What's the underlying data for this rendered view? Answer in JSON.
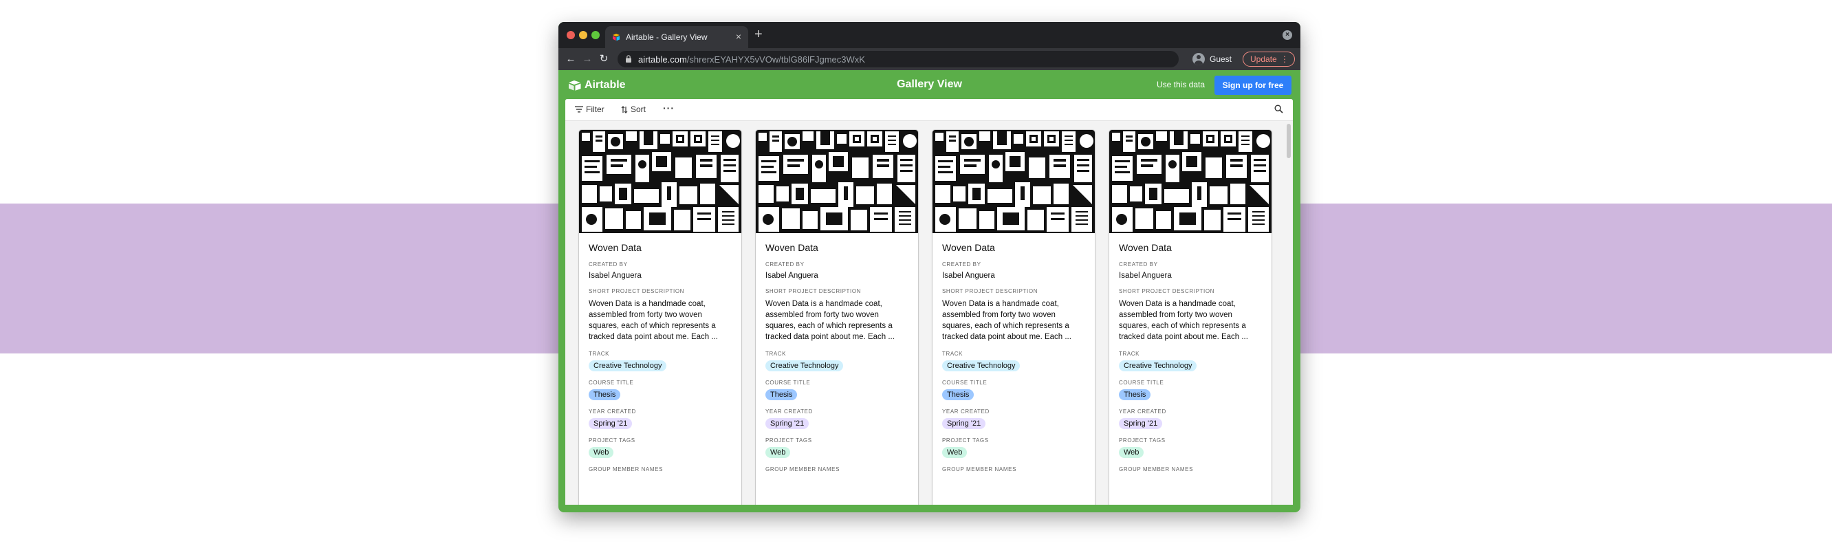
{
  "browser": {
    "tab_title": "Airtable - Gallery View",
    "new_tab": "+",
    "tab_close": "×",
    "url_host": "airtable.com",
    "url_path": "/shrerxEYAHYX5vVOw/tblG86lFJgmec3WxK",
    "profile": "Guest",
    "update": "Update"
  },
  "app": {
    "logo_text": "Airtable",
    "view_title": "Gallery View",
    "use_data": "Use this data",
    "signup": "Sign up for free"
  },
  "viewbar": {
    "filter": "Filter",
    "sort": "Sort",
    "more": "···"
  },
  "labels": {
    "created_by": "CREATED BY",
    "description": "SHORT PROJECT DESCRIPTION",
    "track": "TRACK",
    "course": "COURSE TITLE",
    "year": "YEAR CREATED",
    "tags": "PROJECT TAGS",
    "group": "GROUP MEMBER NAMES"
  },
  "cards": [
    {
      "title": "Woven Data",
      "created_by": "Isabel Anguera",
      "description": "Woven Data is a handmade coat, assembled from forty two woven squares, each of which represents a tracked data point about me. Each ...",
      "track": "Creative Technology",
      "course": "Thesis",
      "year": "Spring '21",
      "tags": "Web"
    },
    {
      "title": "Woven Data",
      "created_by": "Isabel Anguera",
      "description": "Woven Data is a handmade coat, assembled from forty two woven squares, each of which represents a tracked data point about me. Each ...",
      "track": "Creative Technology",
      "course": "Thesis",
      "year": "Spring '21",
      "tags": "Web"
    },
    {
      "title": "Woven Data",
      "created_by": "Isabel Anguera",
      "description": "Woven Data is a handmade coat, assembled from forty two woven squares, each of which represents a tracked data point about me. Each ...",
      "track": "Creative Technology",
      "course": "Thesis",
      "year": "Spring '21",
      "tags": "Web"
    },
    {
      "title": "Woven Data",
      "created_by": "Isabel Anguera",
      "description": "Woven Data is a handmade coat, assembled from forty two woven squares, each of which represents a tracked data point about me. Each ...",
      "track": "Creative Technology",
      "course": "Thesis",
      "year": "Spring '21",
      "tags": "Web"
    }
  ],
  "colors": {
    "header_green": "#5bae49",
    "signup_blue": "#2d7ff9",
    "background_band": "#cfb7de",
    "pill_track": "#d0f0fd",
    "pill_course": "#9cc7ff",
    "pill_year": "#e4dcff",
    "pill_tags": "#cbf5e4"
  }
}
